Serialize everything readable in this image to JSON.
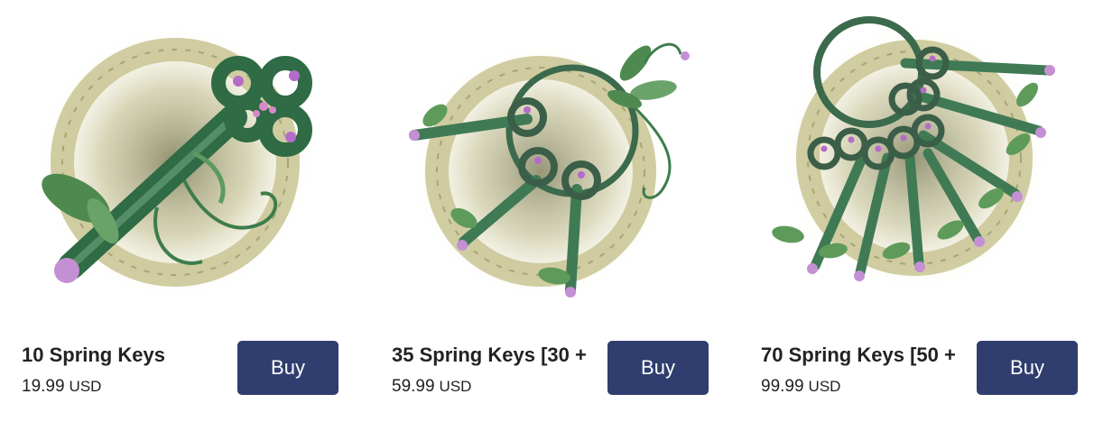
{
  "products": [
    {
      "title": "10 Spring Keys",
      "price": "19.99",
      "currency": "USD",
      "buy_label": "Buy"
    },
    {
      "title": "35 Spring Keys [30 +",
      "price": "59.99",
      "currency": "USD",
      "buy_label": "Buy"
    },
    {
      "title": "70 Spring Keys [50 +",
      "price": "99.99",
      "currency": "USD",
      "buy_label": "Buy"
    }
  ],
  "colors": {
    "button": "#2f3e6e",
    "key_green": "#3f7a55",
    "gem_purple": "#b56cc9",
    "ring_gold": "#bdb98a"
  },
  "icons": [
    "spring-key-icon",
    "spring-keys-bundle-icon",
    "spring-keys-large-bundle-icon"
  ]
}
